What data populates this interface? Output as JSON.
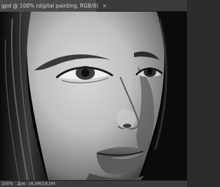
{
  "document_tab": {
    "title": "gpd @ 100% (digital painting, RGB/8)",
    "close_glyph": "×"
  },
  "status_bar": {
    "zoom": "100%",
    "doc_info": "Док: 16,0M/16,0M"
  },
  "canvas": {
    "content": "grayscale digital painting of a woman's face"
  }
}
